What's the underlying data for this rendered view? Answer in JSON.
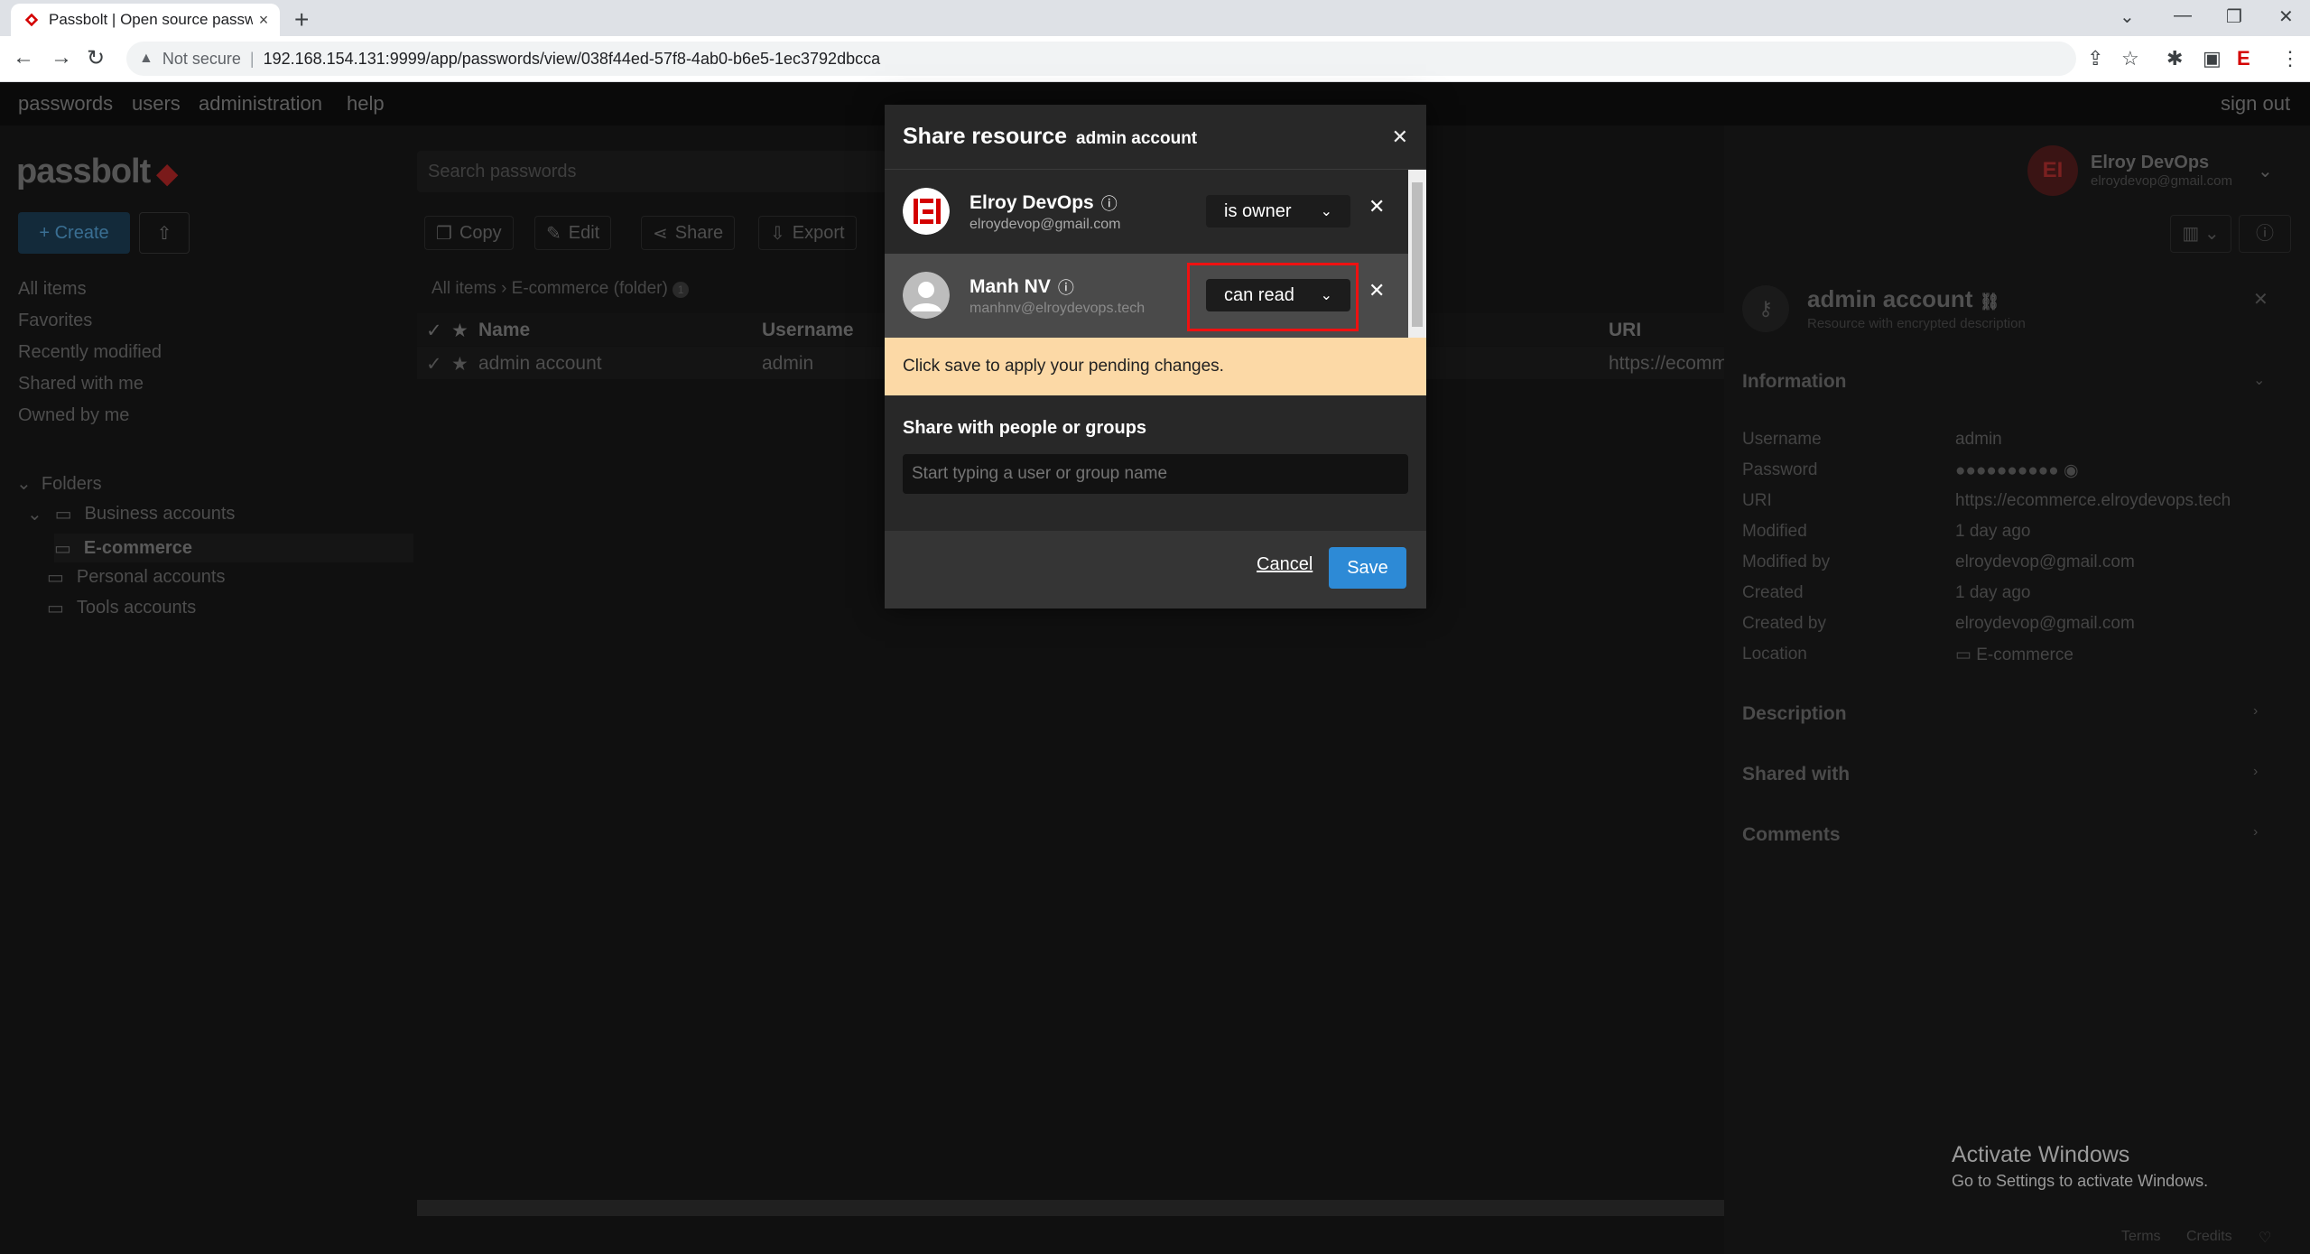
{
  "browser": {
    "tab_title": "Passbolt | Open source passwo",
    "not_secure": "Not secure",
    "url": "192.168.154.131:9999/app/passwords/view/038f44ed-57f8-4ab0-b6e5-1ec3792dbcca"
  },
  "topnav": {
    "passwords": "passwords",
    "users": "users",
    "administration": "administration",
    "help": "help",
    "signout": "sign out"
  },
  "logo": "passbolt",
  "search": {
    "placeholder": "Search passwords"
  },
  "actions": {
    "create": "Create",
    "copy": "Copy",
    "edit": "Edit",
    "share": "Share",
    "export": "Export"
  },
  "filters": [
    "All items",
    "Favorites",
    "Recently modified",
    "Shared with me",
    "Owned by me"
  ],
  "folders": {
    "heading": "Folders",
    "items": [
      "Business accounts",
      "E-commerce",
      "Personal accounts",
      "Tools accounts"
    ]
  },
  "breadcrumb": "All items › E-commerce (folder)",
  "breadcrumb_count": "1",
  "table": {
    "columns": [
      "Name",
      "Username",
      "URI"
    ],
    "rows": [
      {
        "name": "admin account",
        "username": "admin",
        "uri": "https://ecomm"
      }
    ]
  },
  "current_user": {
    "name": "Elroy DevOps",
    "email": "elroydevop@gmail.com",
    "initials": "EI"
  },
  "details": {
    "title": "admin account",
    "subtitle": "Resource with encrypted description",
    "information_heading": "Information",
    "fields": [
      {
        "label": "Username",
        "value": "admin"
      },
      {
        "label": "Password",
        "value": "●●●●●●●●●●"
      },
      {
        "label": "URI",
        "value": "https://ecommerce.elroydevops.tech"
      },
      {
        "label": "Modified",
        "value": "1 day ago"
      },
      {
        "label": "Modified by",
        "value": "elroydevop@gmail.com"
      },
      {
        "label": "Created",
        "value": "1 day ago"
      },
      {
        "label": "Created by",
        "value": "elroydevop@gmail.com"
      },
      {
        "label": "Location",
        "value": "E-commerce"
      }
    ],
    "description_heading": "Description",
    "shared_heading": "Shared with",
    "comments_heading": "Comments"
  },
  "modal": {
    "title": "Share resource",
    "subtitle": "admin account",
    "permissions": [
      {
        "name": "Elroy DevOps",
        "email": "elroydevop@gmail.com",
        "permission": "is owner"
      },
      {
        "name": "Manh NV",
        "email": "manhnv@elroydevops.tech",
        "permission": "can read"
      }
    ],
    "pending_notice": "Click save to apply your pending changes.",
    "share_label": "Share with people or groups",
    "share_placeholder": "Start typing a user or group name",
    "cancel": "Cancel",
    "save": "Save"
  },
  "windows_activation": {
    "line1": "Activate Windows",
    "line2": "Go to Settings to activate Windows."
  },
  "footer": {
    "terms": "Terms",
    "credits": "Credits"
  }
}
